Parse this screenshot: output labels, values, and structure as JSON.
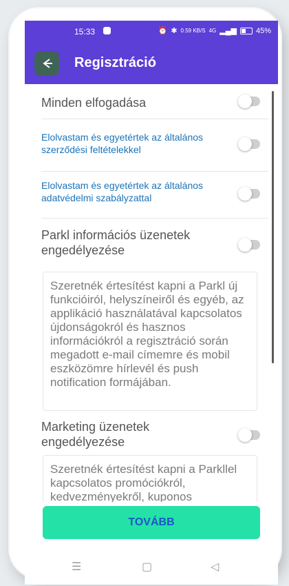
{
  "status": {
    "time": "15:33",
    "net_speed": "0.59 KB/S",
    "signal": "4G",
    "battery": "45%"
  },
  "appbar": {
    "title": "Regisztráció"
  },
  "rows": {
    "accept_all": "Minden elfogadása",
    "terms": "Elolvastam és egyetértek az általános szerződési feltételekkel",
    "privacy": "Elolvastam és egyetértek az általános adatvédelmi szabályzattal",
    "info_messages": "Parkl információs üzenetek engedélyezése",
    "marketing_messages": "Marketing üzenetek engedélyezése"
  },
  "descriptions": {
    "info": "Szeretnék értesítést kapni a Parkl új funkcióiról, helyszíneiről és egyéb, az applikáció használatával kapcsolatos újdonságokról és hasznos információkról a regisztráció során megadott e-mail címemre és mobil eszközömre hírlevél és push notification formájában.",
    "marketing": "Szeretnék értesítést kapni a Parkllel kapcsolatos promóciókról, kedvezményekről, kuponos"
  },
  "buttons": {
    "next": "TOVÁBB"
  },
  "colors": {
    "primary": "#5b3fd6",
    "accent": "#24e2a7",
    "link": "#1a73b8"
  }
}
